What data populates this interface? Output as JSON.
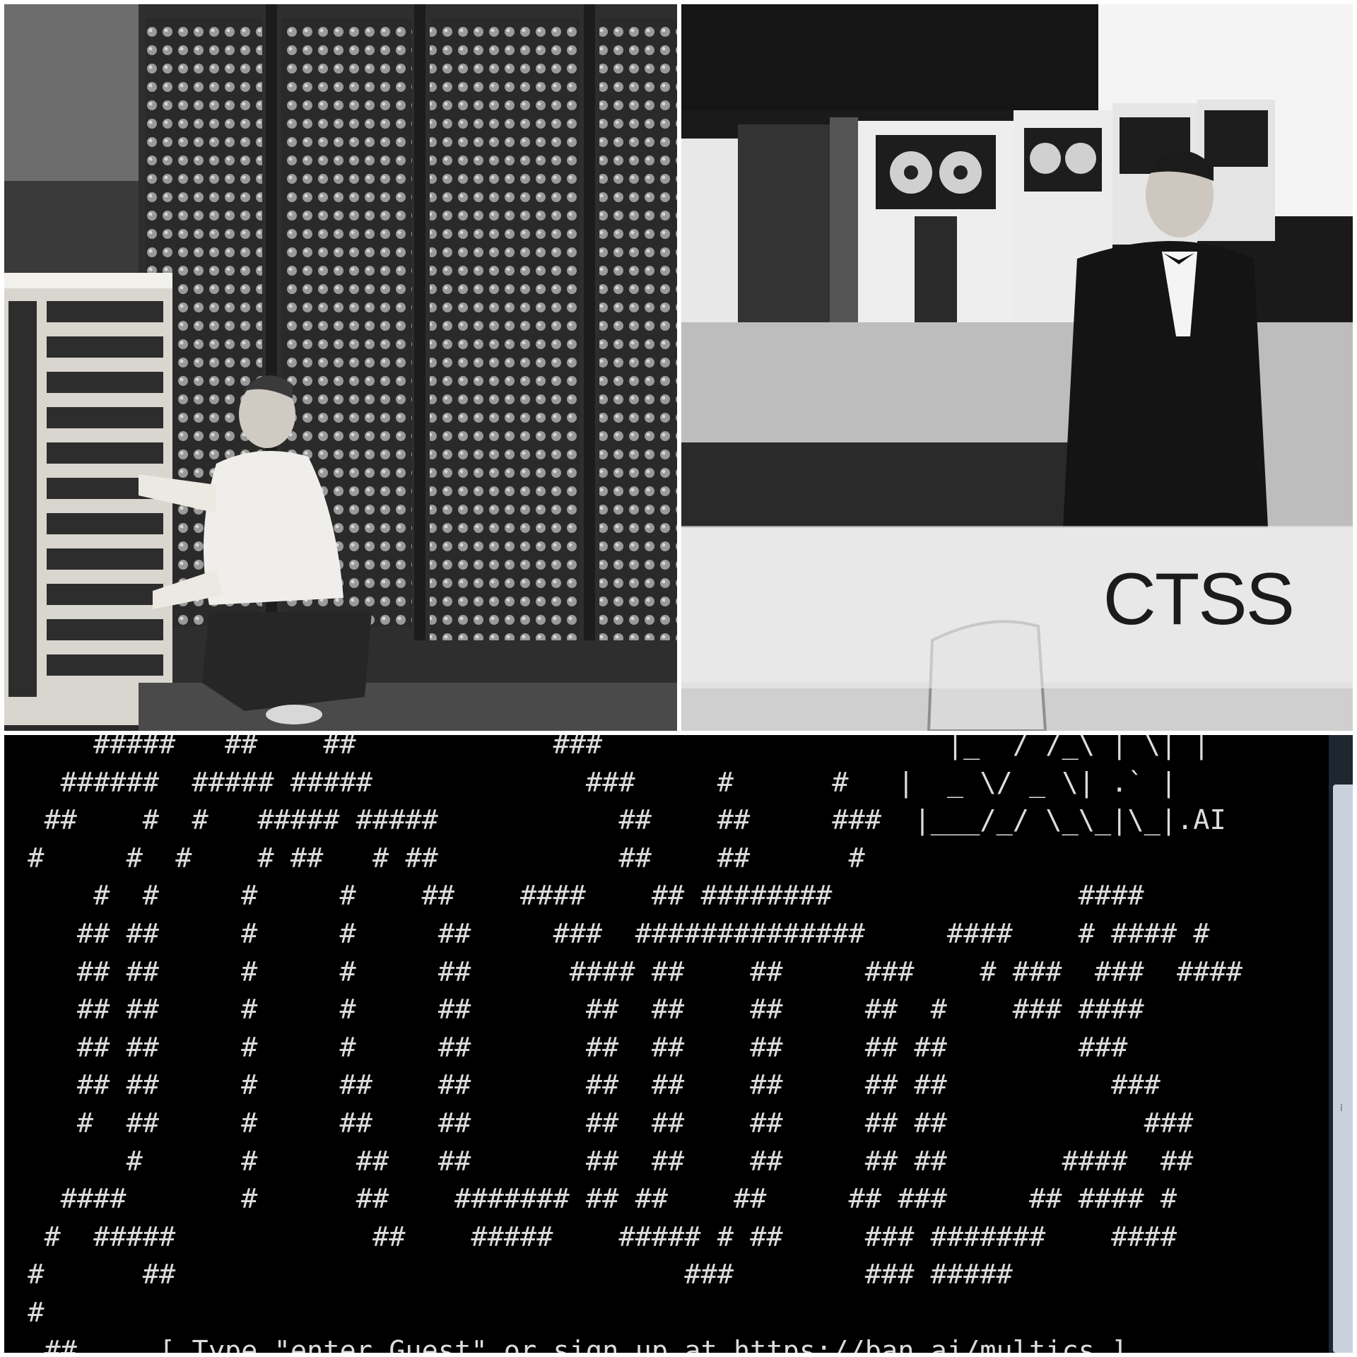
{
  "photos": {
    "left": {
      "subject": "vacuum-tube computer being serviced"
    },
    "right": {
      "subject": "mainframe room with tape drives and console",
      "caption": "CTSS"
    }
  },
  "terminal": {
    "lines": [
      "     #####   ##    ##            ###                     |_  / /_\\ | \\| |",
      "   ######  ##### #####             ###     #      #   |  _ \\/ _ \\| .` |",
      "  ##    #  #   ##### #####           ##    ##     ###  |___/_/ \\_\\_|\\_|.AI",
      " #     #  #    # ##   # ##           ##    ##      #",
      "     #  #     #     #    ##    ####    ## ########               ####",
      "    ## ##     #     #     ##     ###  ##############     ####    # #### #",
      "    ## ##     #     #     ##      #### ##    ##     ###    # ###  ###  ####",
      "    ## ##     #     #     ##       ##  ##    ##     ##  #    ### ####",
      "    ## ##     #     #     ##       ##  ##    ##     ## ##        ###",
      "    ## ##     #     ##    ##       ##  ##    ##     ## ##          ###",
      "    #  ##     #     ##    ##       ##  ##    ##     ## ##            ###",
      "       #      #      ##   ##       ##  ##    ##     ## ##       ####  ##",
      "   ####       #      ##    ####### ## ##    ##     ## ###     ## #### #",
      "  #  #####            ##    #####    ##### # ##     ### #######    ####",
      " #      ##                               ###        ### #####",
      " #",
      "  ##     [ Type \"enter Guest\" or sign up at https://ban.ai/multics ]"
    ]
  },
  "colors": {
    "terminal_bg": "#000000",
    "terminal_fg": "#dcdcdc",
    "caption_band": "#ebebeb"
  }
}
